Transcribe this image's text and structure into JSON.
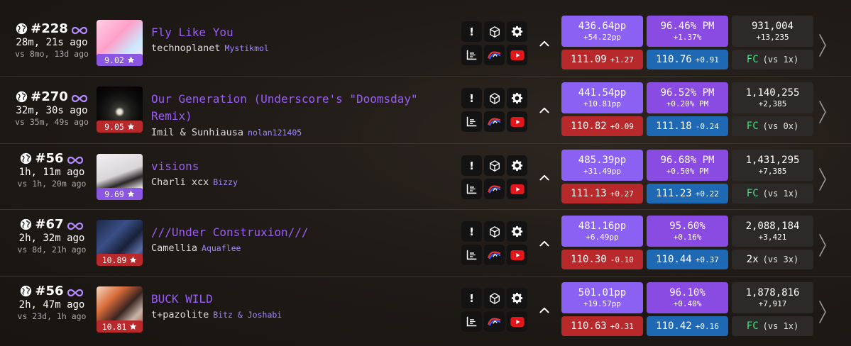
{
  "colors": {
    "accent": "#9b5cf6",
    "pp": "#8b61f3",
    "acc": "#8a4be3",
    "red": "#b7292b",
    "blue": "#1f68b4",
    "fc_green": "#4ade80",
    "stars_purple": "#8a56e2",
    "stars_red": "#b7292b"
  },
  "icons": [
    "globe-icon",
    "meta-infinity-icon",
    "star-icon",
    "report-icon",
    "cube-icon",
    "gear-icon",
    "graph-icon",
    "replay-icon",
    "youtube-icon",
    "chevron-up-icon",
    "chevron-right-icon"
  ],
  "buttons": {
    "report_label": "!"
  },
  "scores": [
    {
      "rank": "#228",
      "time_ago": "28m, 21s ago",
      "vs_ago": "vs 8mo, 13d ago",
      "stars": "9.02",
      "stars_color": "purple",
      "title": "Fly Like You",
      "artist": "technoplanet",
      "mapper": "Mystikmol",
      "pp": "436.64pp",
      "pp_gain": "+54.22pp",
      "acc": "96.46% PM",
      "acc_gain": "+1.37%",
      "score": "931,004",
      "score_gain": "+13,235",
      "left_val": "111.09",
      "left_delta": "+1.27",
      "right_val": "110.76",
      "right_delta": "+0.91",
      "fc": "FC",
      "fc_is_full": true,
      "fc_vs": "(vs 1x)"
    },
    {
      "rank": "#270",
      "time_ago": "32m, 30s ago",
      "vs_ago": "vs 35m, 49s ago",
      "stars": "9.05",
      "stars_color": "red",
      "title": "Our Generation (Underscore's \"Doomsday\" Remix)",
      "artist": "Imil & Sunhiausa",
      "mapper": "nolan121405",
      "pp": "441.54pp",
      "pp_gain": "+10.81pp",
      "acc": "96.52% PM",
      "acc_gain": "+0.20% PM",
      "score": "1,140,255",
      "score_gain": "+2,385",
      "left_val": "110.82",
      "left_delta": "+0.09",
      "right_val": "111.18",
      "right_delta": "-0.24",
      "fc": "FC",
      "fc_is_full": true,
      "fc_vs": "(vs 0x)"
    },
    {
      "rank": "#56",
      "time_ago": "1h, 11m ago",
      "vs_ago": "vs 1h, 20m ago",
      "stars": "9.69",
      "stars_color": "purple",
      "title": "visions",
      "artist": "Charli xcx",
      "mapper": "Bizzy",
      "pp": "485.39pp",
      "pp_gain": "+31.49pp",
      "acc": "96.68% PM",
      "acc_gain": "+0.50% PM",
      "score": "1,431,295",
      "score_gain": "+7,385",
      "left_val": "111.13",
      "left_delta": "+0.27",
      "right_val": "111.23",
      "right_delta": "+0.22",
      "fc": "FC",
      "fc_is_full": true,
      "fc_vs": "(vs 1x)"
    },
    {
      "rank": "#67",
      "time_ago": "2h, 32m ago",
      "vs_ago": "vs 8d, 21h ago",
      "stars": "10.89",
      "stars_color": "red",
      "title": "///Under Construxion///",
      "artist": "Camellia",
      "mapper": "Aquaflee",
      "pp": "481.16pp",
      "pp_gain": "+6.49pp",
      "acc": "95.60%",
      "acc_gain": "+0.16%",
      "score": "2,088,184",
      "score_gain": "+3,421",
      "left_val": "110.30",
      "left_delta": "-0.10",
      "right_val": "110.44",
      "right_delta": "+0.37",
      "fc": "2x",
      "fc_is_full": false,
      "fc_vs": "(vs 3x)"
    },
    {
      "rank": "#56",
      "time_ago": "2h, 47m ago",
      "vs_ago": "vs 23d, 1h ago",
      "stars": "10.81",
      "stars_color": "red",
      "title": "BUCK WILD",
      "artist": "t+pazolite",
      "mapper": "Bitz & Joshabi",
      "pp": "501.01pp",
      "pp_gain": "+19.57pp",
      "acc": "96.10%",
      "acc_gain": "+0.40%",
      "score": "1,878,816",
      "score_gain": "+7,917",
      "left_val": "110.63",
      "left_delta": "+0.31",
      "right_val": "110.42",
      "right_delta": "+0.16",
      "fc": "FC",
      "fc_is_full": true,
      "fc_vs": "(vs 1x)"
    }
  ]
}
